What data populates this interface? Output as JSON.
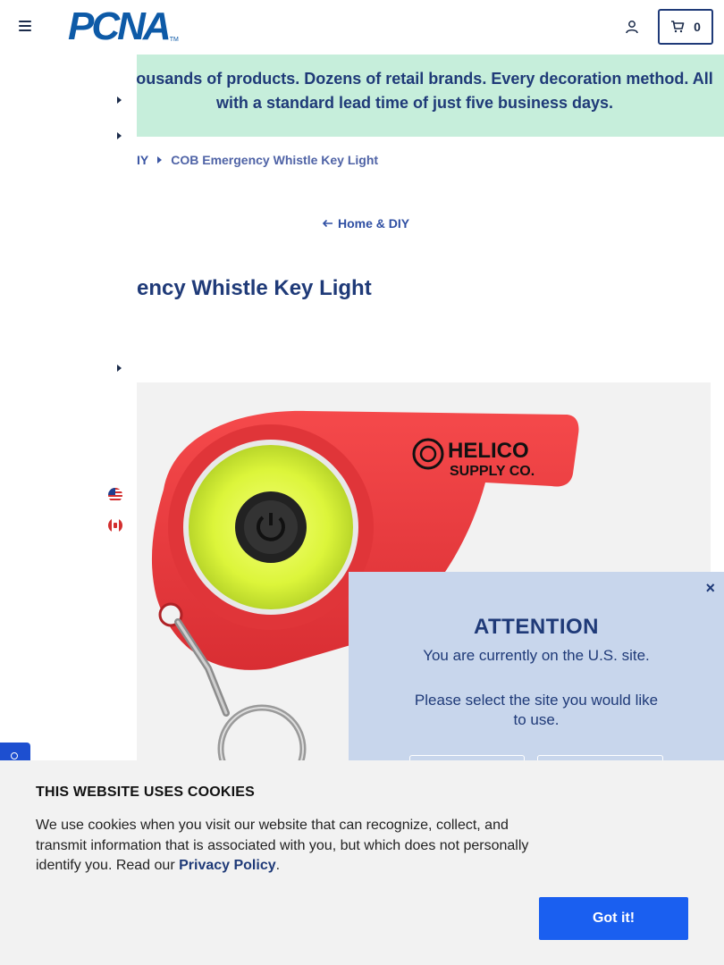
{
  "header": {
    "logo_text": "PCNA",
    "logo_tm": "TM",
    "cart_count": "0"
  },
  "banner": {
    "text": "Thousands of products. Dozens of retail brands. Every decoration method. All with a standard lead time of just five business days."
  },
  "breadcrumb": {
    "parent": "Home & DIY",
    "parent_visible": "IY",
    "current": "COB Emergency Whistle Key Light"
  },
  "back_link": {
    "label": "Home & DIY"
  },
  "product": {
    "title": "COB Emergency Whistle Key Light",
    "title_visible": "ency Whistle Key Light",
    "image": {
      "brand_line1": "HELICO",
      "brand_line2": "SUPPLY CO."
    }
  },
  "modal": {
    "close_label": "×",
    "title": "ATTENTION",
    "line1": "You are currently on the U.S. site.",
    "line2": "Please select the site you would like to use."
  },
  "cookie": {
    "title": "THIS WEBSITE USES COOKIES",
    "body": "We use cookies when you visit our website that can recognize, collect, and transmit information that is associated with you, but which does not personally identify you. Read our ",
    "link": "Privacy Policy",
    "end": ".",
    "button": "Got it!"
  },
  "colors": {
    "brand": "#0d5aa7",
    "navy": "#1f3a78",
    "banner_bg": "#c6eedb",
    "modal_bg": "#c8d6ec",
    "cookie_button": "#1a5ff0",
    "whistle_red": "#ee3b3f",
    "light_yellow": "#e6ff3a"
  }
}
